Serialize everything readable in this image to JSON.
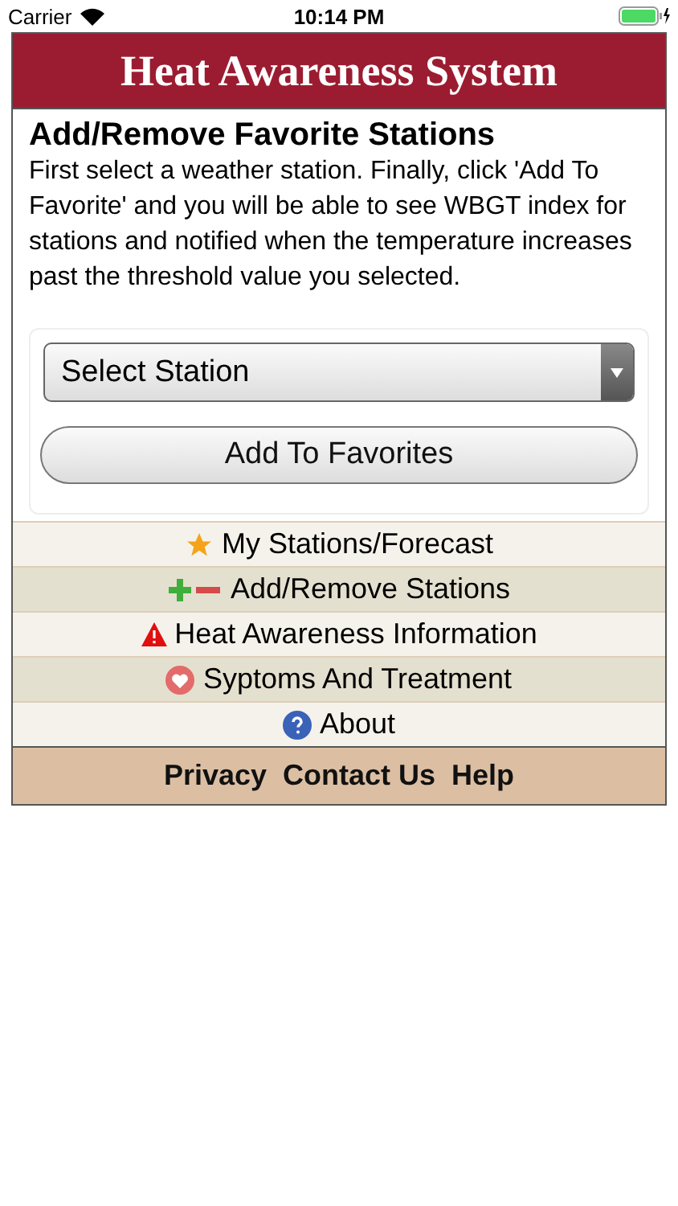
{
  "status_bar": {
    "carrier": "Carrier",
    "time": "10:14 PM"
  },
  "header": {
    "title": "Heat Awareness System"
  },
  "content": {
    "title": "Add/Remove Favorite Stations",
    "description": "First select a weather station. Finally, click 'Add To Favorite' and you will be able to see WBGT index for stations and notified when the temperature increases past the threshold value you selected.",
    "select": {
      "value": "Select Station"
    },
    "button": "Add To Favorites"
  },
  "menu": [
    {
      "kind": "star",
      "label": "My Stations/Forecast"
    },
    {
      "kind": "plusminus",
      "label": "Add/Remove Stations"
    },
    {
      "kind": "warning",
      "label": "Heat Awareness Information"
    },
    {
      "kind": "heart",
      "label": "Syptoms And Treatment"
    },
    {
      "kind": "help",
      "label": "About"
    }
  ],
  "footer": {
    "links": [
      "Privacy",
      "Contact Us",
      "Help"
    ]
  }
}
